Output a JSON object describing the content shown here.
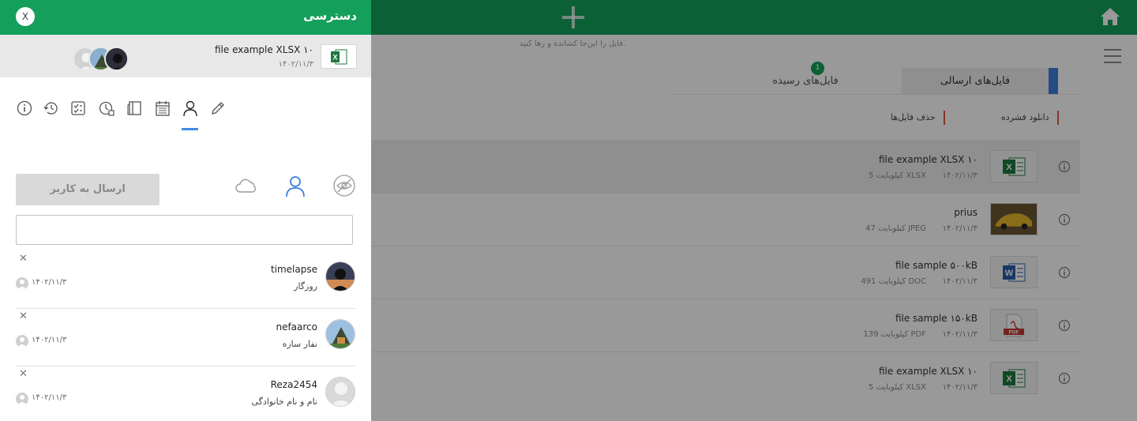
{
  "header": {
    "drop_hint": "فایل را این‌جا کشانده و رها کنید."
  },
  "tabs": {
    "sent": "فایل‌های ارسالی",
    "received": "فایل‌های رسیده",
    "received_badge": "1"
  },
  "actions": {
    "download": "دانلود فشرده",
    "delete": "حذف فایل‌ها"
  },
  "files": [
    {
      "name": "file example XLSX ۱۰",
      "date": "۱۴۰۲/۱۱/۳",
      "size": "5 کیلوبایت XLSX",
      "type": "xlsx"
    },
    {
      "name": "prius",
      "date": "۱۴۰۲/۱۱/۳",
      "size": "47 کیلوبایت JPEG",
      "type": "jpeg"
    },
    {
      "name": "file sample ۵۰۰kB",
      "date": "۱۴۰۲/۱۱/۳",
      "size": "491 کیلوبایت DOC",
      "type": "doc"
    },
    {
      "name": "file sample ۱۵۰kB",
      "date": "۱۴۰۲/۱۱/۳",
      "size": "139 کیلوبایت PDF",
      "type": "pdf"
    },
    {
      "name": "file example XLSX ۱۰",
      "date": "۱۴۰۲/۱۱/۳",
      "size": "5 کیلوبایت XLSX",
      "type": "xlsx"
    }
  ],
  "panel": {
    "title": "دسترسی",
    "close_label": "X",
    "file": {
      "name": "file example XLSX ۱۰",
      "date": "۱۴۰۲/۱۱/۳"
    },
    "send_button": "ارسال به کاربر",
    "input_value": "",
    "icons": {
      "tools": [
        "info-icon",
        "history-icon",
        "checklist-icon",
        "clock-icon",
        "book-icon",
        "calendar-icon",
        "user-icon",
        "pencil-icon"
      ],
      "modes": [
        "cloud-icon",
        "user-icon",
        "eye-off-icon"
      ]
    },
    "colors": {
      "brand": "#14a05a",
      "active_tab_accent": "#3f7de0",
      "active_tool": "#3f8de0"
    }
  },
  "shared_users": [
    {
      "username": "timelapse",
      "fullname": "روزگار",
      "date": "۱۴۰۲/۱۱/۳",
      "avatar": "dark-sunset"
    },
    {
      "username": "nefaarco",
      "fullname": "نفار سازه",
      "date": "۱۴۰۲/۱۱/۳",
      "avatar": "cabin"
    },
    {
      "username": "Reza2454",
      "fullname": "نام و نام خانوادگی",
      "date": "۱۴۰۲/۱۱/۳",
      "avatar": "default"
    }
  ]
}
